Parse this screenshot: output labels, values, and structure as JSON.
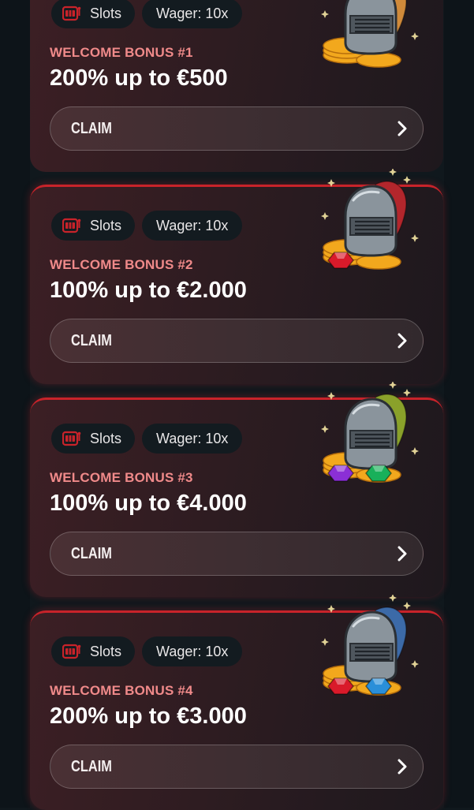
{
  "cards": [
    {
      "tag_category": "Slots",
      "tag_wager": "Wager: 10x",
      "label": "WELCOME BONUS #1",
      "amount": "200% up to €500",
      "claim": "CLAIM",
      "plume_color": "#d08a3a",
      "gem_colors": []
    },
    {
      "tag_category": "Slots",
      "tag_wager": "Wager: 10x",
      "label": "WELCOME BONUS #2",
      "amount": "100% up to €2.000",
      "claim": "CLAIM",
      "plume_color": "#b3262c",
      "gem_colors": [
        "#d91a2a"
      ]
    },
    {
      "tag_category": "Slots",
      "tag_wager": "Wager: 10x",
      "label": "WELCOME BONUS #3",
      "amount": "100% up to €4.000",
      "claim": "CLAIM",
      "plume_color": "#8aa12a",
      "gem_colors": [
        "#8b2fd6",
        "#19b05a"
      ]
    },
    {
      "tag_category": "Slots",
      "tag_wager": "Wager: 10x",
      "label": "WELCOME BONUS #4",
      "amount": "200% up to €3.000",
      "claim": "CLAIM",
      "plume_color": "#3c6aa8",
      "gem_colors": [
        "#d91a2a",
        "#2a8fd9"
      ]
    }
  ],
  "colors": {
    "accent_red": "#c8232a",
    "label_pink": "#f08a8a",
    "coin_gold": "#f2a81d"
  },
  "icons": {
    "tag_icon": "slot-machine-icon",
    "claim_icon": "chevron-right-icon",
    "art": "knight-helmet-coins-illustration"
  }
}
